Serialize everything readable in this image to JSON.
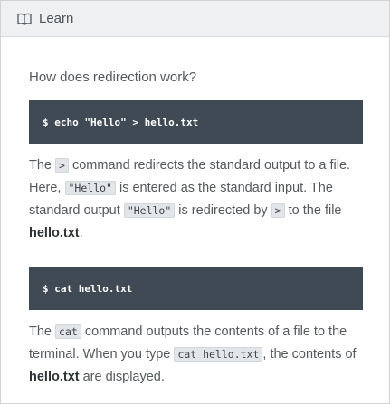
{
  "header": {
    "icon": "book-open-icon",
    "title": "Learn"
  },
  "lesson": {
    "question": "How does redirection work?",
    "code1": "$ echo \"Hello\" > hello.txt",
    "para1": {
      "t1": "The ",
      "c1": ">",
      "t2": " command redirects the standard output to a file. Here, ",
      "c2": "\"Hello\"",
      "t3": " is entered as the standard input. The standard output ",
      "c3": "\"Hello\"",
      "t4": " is redirected by ",
      "c4": ">",
      "t5": " to the file ",
      "b1": "hello.txt",
      "t6": "."
    },
    "code2": "$ cat hello.txt",
    "para2": {
      "t1": "The ",
      "c1": "cat",
      "t2": " command outputs the contents of a file to the terminal. When you type ",
      "c2": "cat hello.txt",
      "t3": ", the contents of ",
      "b1": "hello.txt",
      "t4": " are displayed."
    }
  },
  "colors": {
    "header_bg": "#eef0f2",
    "code_bg": "#3f4a54",
    "inline_code_bg": "#e3e6e9"
  }
}
